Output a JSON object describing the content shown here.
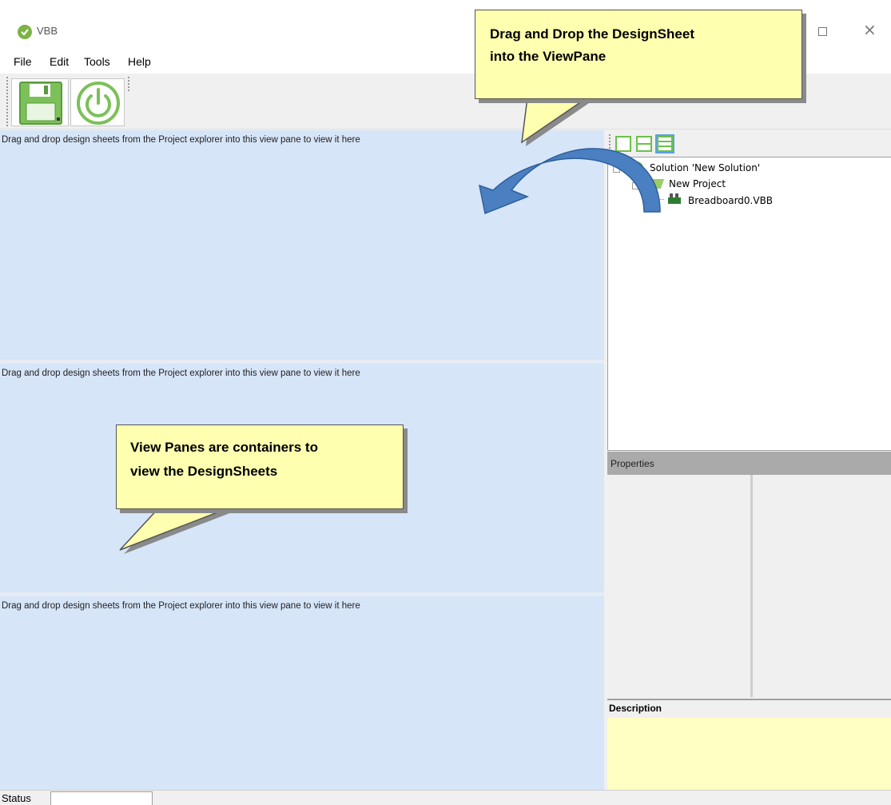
{
  "window": {
    "title": "VBB"
  },
  "menu": {
    "items": [
      "File",
      "Edit",
      "Tools",
      "Help"
    ]
  },
  "toolbar": {
    "buttons": [
      {
        "icon": "save-icon"
      },
      {
        "icon": "power-icon"
      }
    ]
  },
  "view_panes": {
    "hint": "Drag and drop design sheets from the Project explorer into this view pane to view it here"
  },
  "explorer": {
    "layout_buttons": [
      {
        "icon": "single-pane-layout-icon"
      },
      {
        "icon": "two-pane-layout-icon"
      },
      {
        "icon": "three-pane-layout-icon",
        "active": true
      }
    ],
    "tree": {
      "solution": "Solution 'New Solution'",
      "project": "New Project",
      "file": "Breadboard0.VBB"
    }
  },
  "properties": {
    "title": "Properties"
  },
  "description": {
    "title": "Description"
  },
  "status": {
    "label": "Status"
  },
  "callouts": {
    "drag_drop": {
      "line1": "Drag and Drop the DesignSheet",
      "line2": "into the ViewPane"
    },
    "view_panes": {
      "line1": "View Panes are containers to",
      "line2": "view the DesignSheets"
    }
  },
  "colors": {
    "accent_green": "#7cb342",
    "view_pane_bg": "#d6e5f8",
    "callout_bg": "#ffffb0",
    "arrow_blue": "#4a7fc1",
    "description_bg": "#ffffc4"
  }
}
